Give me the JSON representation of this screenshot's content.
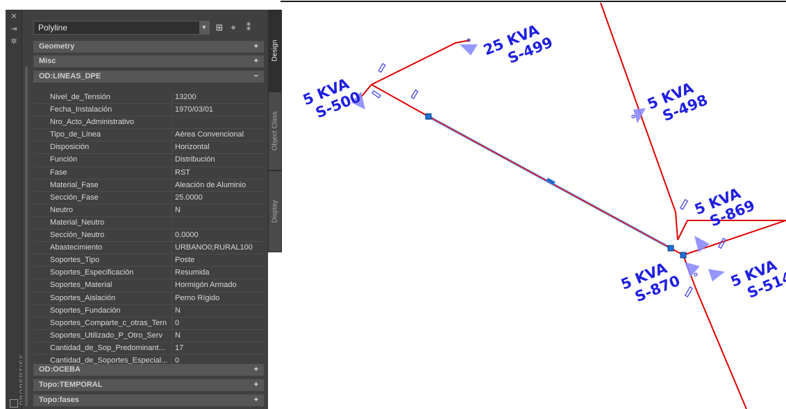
{
  "drawing": {
    "labels": [
      {
        "kva": "25  KVA",
        "id": "S-499"
      },
      {
        "kva": "5  KVA",
        "id": "S-500"
      },
      {
        "kva": "5  KVA",
        "id": "S-498"
      },
      {
        "kva": "5  KVA",
        "id": "S-869"
      },
      {
        "kva": "5  KVA",
        "id": "S-870"
      },
      {
        "kva": "5  KVA",
        "id": "S-514"
      }
    ],
    "line_color": "#e00000",
    "label_color": "#1f1fe0",
    "selection_color": "#6aa9ff"
  },
  "palette": {
    "title": "PROPERTIES",
    "object_type": "Polyline",
    "toolbar_icons": [
      "quick-select-icon",
      "select-objects-icon",
      "toggle-pickadd-icon"
    ],
    "sections": {
      "geometry": {
        "label": "Geometry",
        "toggle": "+"
      },
      "misc": {
        "label": "Misc",
        "toggle": "+"
      },
      "od_lineas": {
        "label": "OD:LINEAS_DPE",
        "toggle": "−"
      },
      "od_oceba": {
        "label": "OD:OCEBA",
        "toggle": "+"
      },
      "topo_temporal": {
        "label": "Topo:TEMPORAL",
        "toggle": "+"
      },
      "topo_fases": {
        "label": "Topo:fases",
        "toggle": "+"
      }
    },
    "properties": [
      {
        "key": "Nivel_de_Tensión",
        "value": "13200"
      },
      {
        "key": "Fecha_Instalación",
        "value": "1970/03/01"
      },
      {
        "key": "Nro_Acto_Administrativo",
        "value": ""
      },
      {
        "key": "Tipo_de_Línea",
        "value": "Aérea Convencional"
      },
      {
        "key": "Disposición",
        "value": "Horizontal"
      },
      {
        "key": "Función",
        "value": "Distribución"
      },
      {
        "key": "Fase",
        "value": "RST"
      },
      {
        "key": "Material_Fase",
        "value": "Aleación de Aluminio"
      },
      {
        "key": "Sección_Fase",
        "value": "25.0000"
      },
      {
        "key": "Neutro",
        "value": "N"
      },
      {
        "key": "Material_Neutro",
        "value": ""
      },
      {
        "key": "Sección_Neutro",
        "value": "0.0000"
      },
      {
        "key": "Abastecimiento",
        "value": "URBANO0;RURAL100"
      },
      {
        "key": "Soportes_Tipo",
        "value": "Poste"
      },
      {
        "key": "Soportes_Especificación",
        "value": "Resumida"
      },
      {
        "key": "Soportes_Material",
        "value": "Hormigón Armado"
      },
      {
        "key": "Soportes_Aislación",
        "value": "Perno Rígido"
      },
      {
        "key": "Soportes_Fundación",
        "value": "N"
      },
      {
        "key": "Soportes_Comparte_c_otras_Tern",
        "value": "0"
      },
      {
        "key": "Soportes_Utilizado_P_Otro_Serv",
        "value": "N"
      },
      {
        "key": "Cantidad_de_Sop_Predominant...",
        "value": "17"
      },
      {
        "key": "Cantidad_de_Soportes_Especial...",
        "value": "0"
      }
    ],
    "tabs": [
      "Design",
      "Object Class",
      "Display"
    ]
  }
}
